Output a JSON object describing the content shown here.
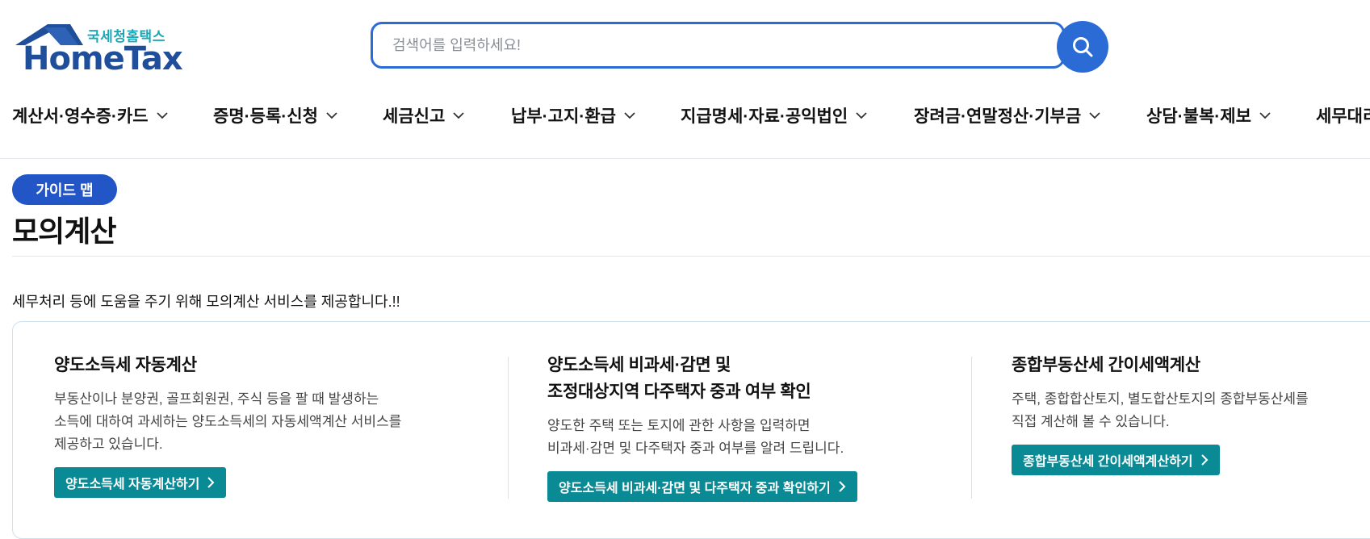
{
  "header": {
    "logo_sub": "국세청홈택스",
    "logo_main": "HomeTax",
    "search_placeholder": "검색어를 입력하세요!"
  },
  "nav": [
    {
      "label": "계산서·영수증·카드"
    },
    {
      "label": "증명·등록·신청"
    },
    {
      "label": "세금신고"
    },
    {
      "label": "납부·고지·환급"
    },
    {
      "label": "지급명세·자료·공익법인"
    },
    {
      "label": "장려금·연말정산·기부금"
    },
    {
      "label": "상담·불복·제보"
    },
    {
      "label": "세무대리"
    }
  ],
  "content": {
    "badge": "가이드 맵",
    "title": "모의계산",
    "intro": "세무처리 등에 도움을 주기 위해 모의계산 서비스를 제공합니다.!!",
    "cards": [
      {
        "title_line1": "양도소득세 자동계산",
        "title_line2": "",
        "desc_line1": "부동산이나 분양권, 골프회원권, 주식 등을 팔 때 발생하는",
        "desc_line2": "소득에 대하여 과세하는 양도소득세의 자동세액계산 서비스를",
        "desc_line3": "제공하고 있습니다.",
        "button": "양도소득세 자동계산하기"
      },
      {
        "title_line1": "양도소득세 비과세·감면 및",
        "title_line2": "조정대상지역 다주택자 중과 여부 확인",
        "desc_line1": "양도한 주택 또는 토지에 관한 사항을 입력하면",
        "desc_line2": "비과세·감면 및 다주택자 중과 여부를 알려 드립니다.",
        "desc_line3": "",
        "button": "양도소득세 비과세·감면 및 다주택자 중과 확인하기"
      },
      {
        "title_line1": "종합부동산세 간이세액계산",
        "title_line2": "",
        "desc_line1": "주택, 종합합산토지, 별도합산토지의 종합부동산세를",
        "desc_line2": "직접 계산해 볼 수 있습니다.",
        "desc_line3": "",
        "button": "종합부동산세 간이세액계산하기"
      }
    ]
  },
  "colors": {
    "brand_blue": "#2b6bd6",
    "badge_blue": "#2255c6",
    "teal_button": "#0a8a94",
    "logo_navy": "#1f4e9a",
    "logo_teal": "#1aa8b8"
  },
  "icons": {
    "search": "search-icon",
    "chevron": "chevron-down-icon",
    "arrow": "chevron-right-icon"
  }
}
